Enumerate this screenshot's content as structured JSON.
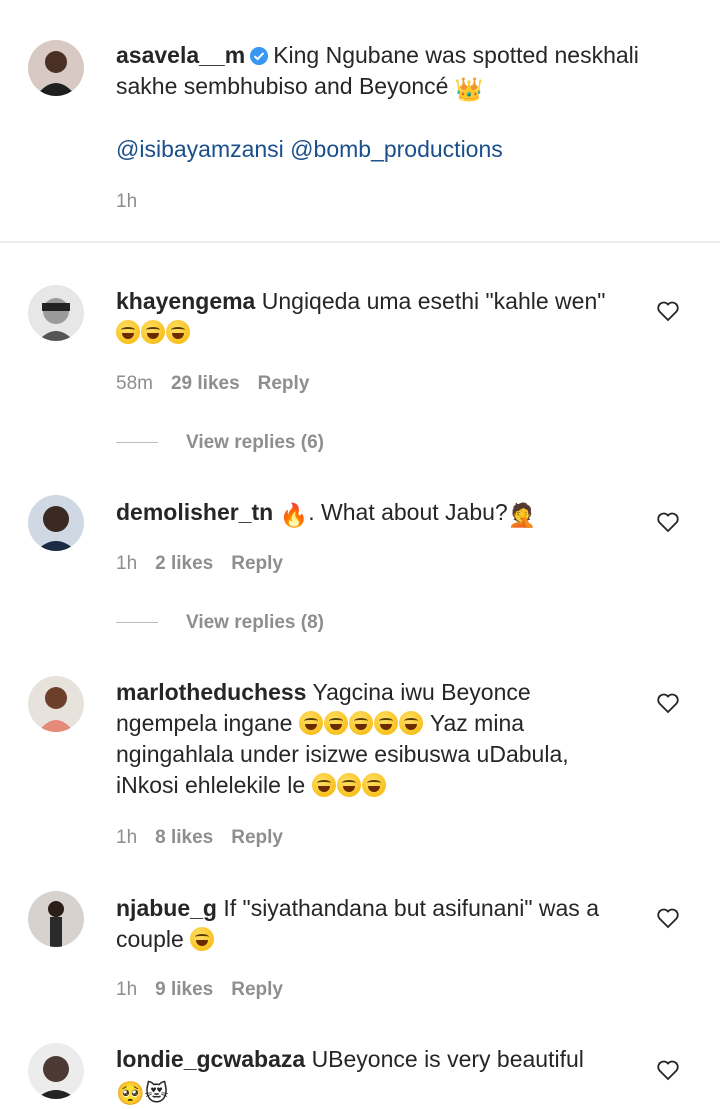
{
  "caption": {
    "username": "asavela__m",
    "text_line1": "King Ngubane was spotted neskhali",
    "text_line2": "sakhe sembhubiso and Beyoncé",
    "mentions": "@isibayamzansi @bomb_productions",
    "time": "1h",
    "avatar_icon": "profile-photo-woman",
    "verified_icon": "verified-badge-icon",
    "crown_icon": "crown-emoji"
  },
  "comments": [
    {
      "username": "khayengema",
      "text_line1": "Ungiqeda uma esethi \"kahle wen\"",
      "emoji": "laughing-emoji x3",
      "time": "58m",
      "likes": "29 likes",
      "reply": "Reply",
      "view_replies": "View replies (6)"
    },
    {
      "username": "demolisher_tn",
      "text_line1": ". What about Jabu?",
      "emoji": "fire-emoji, facepalm-emoji",
      "time": "1h",
      "likes": "2 likes",
      "reply": "Reply",
      "view_replies": "View replies (8)"
    },
    {
      "username": "marlotheduchess",
      "text_line1": "Yagcina iwu Beyonce",
      "text_line2": "ngempela ingane",
      "text_line2b": "Yaz mina",
      "text_line3": "ngingahlala under isizwe esibuswa uDabula,",
      "text_line4": "iNkosi ehlelekile le",
      "emoji": "grinning-sweat-emoji",
      "time": "1h",
      "likes": "8 likes",
      "reply": "Reply"
    },
    {
      "username": "njabue_g",
      "text_line1": "If \"siyathandana but asifunani\" was a",
      "text_line2": "couple",
      "emoji": "grinning-sweat-emoji",
      "time": "1h",
      "likes": "9 likes",
      "reply": "Reply"
    },
    {
      "username": "londie_gcwabaza",
      "text_line1": "UBeyonce is very beautiful",
      "emoji": "pleading-emoji, heart-eyes-cat-emoji",
      "time": "",
      "likes": "",
      "reply": ""
    }
  ],
  "colors": {
    "text": "#262626",
    "meta": "#8e8e8e",
    "mention": "#1a4f8b",
    "verified": "#3897f0"
  }
}
